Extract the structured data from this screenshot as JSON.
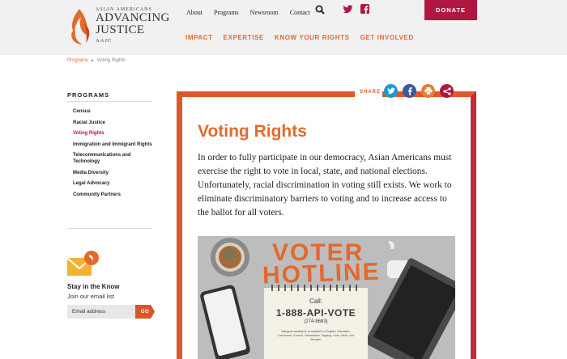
{
  "brand": {
    "small": "ASIAN AMERICANS",
    "line1": "ADVANCING",
    "line2": "JUSTICE",
    "aajc": "AAJC",
    "accent": "#e26a2c",
    "donate_color": "#b0173f"
  },
  "utility_nav": [
    "About",
    "Programs",
    "Newsroom",
    "Contact"
  ],
  "icons": [
    "search-icon",
    "twitter-icon",
    "facebook-icon"
  ],
  "donate_label": "DONATE",
  "main_nav": [
    "IMPACT",
    "EXPERTISE",
    "KNOW YOUR RIGHTS",
    "GET INVOLVED"
  ],
  "breadcrumb": {
    "root": "Programs",
    "current": "Voting Rights"
  },
  "sidebar": {
    "title": "PROGRAMS",
    "items": [
      "Census",
      "Racial Justice",
      "Voting Rights",
      "Immigration and Immigrant Rights",
      "Telecommunications and Technology",
      "Media Diversity",
      "Legal Advocacy",
      "Community Partners"
    ],
    "active_index": 2
  },
  "newsletter": {
    "title": "Stay in the Know",
    "subtitle": "Join our email list",
    "placeholder": "Email address",
    "go_label": "GO"
  },
  "share": {
    "label": "SHARE",
    "buttons": [
      "twitter-icon",
      "facebook-icon",
      "print-icon",
      "share-icon"
    ]
  },
  "page": {
    "title": "Voting Rights",
    "intro": "In order to fully participate in our democracy, Asian Americans must exercise the right to vote in local, state, and national elections. Unfortunately, racial discrimination in voting still exists. We work to eliminate discriminatory barriers to voting and to increase access to the ballot for all voters."
  },
  "hotline_image": {
    "line1": "VOTER",
    "line2": "HOTLINE",
    "call": "Call:",
    "number": "1-888-API-VOTE",
    "digits": "(274-8683)",
    "blurb": "Bilingual assistance is available in English, Mandarin, Cantonese, Korean, Vietnamese, Tagalog, Urdu, Hindi, and Bengali."
  }
}
